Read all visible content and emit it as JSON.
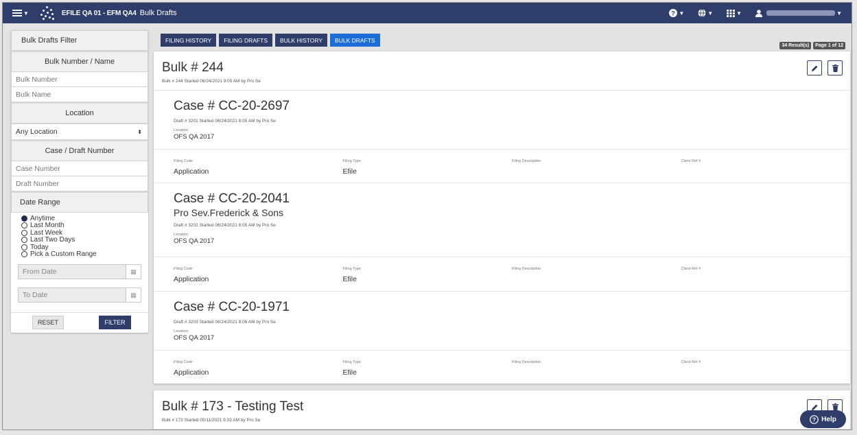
{
  "header": {
    "app_title": "EFILE QA 01 - EFM QA4",
    "page_title": "Bulk Drafts",
    "icons": [
      "menu-icon",
      "logo-icon",
      "help-icon",
      "globe-icon",
      "grid-icon",
      "user-icon"
    ]
  },
  "sidebar": {
    "title": "Bulk Drafts Filter",
    "bulk_section": "Bulk Number / Name",
    "bulk_number_placeholder": "Bulk Number",
    "bulk_name_placeholder": "Bulk Name",
    "location_section": "Location",
    "location_value": "Any Location",
    "case_section": "Case / Draft Number",
    "case_number_placeholder": "Case Number",
    "draft_number_placeholder": "Draft Number",
    "date_section": "Date Range",
    "date_options": [
      "Anytime",
      "Last Month",
      "Last Week",
      "Last Two Days",
      "Today",
      "Pick a Custom Range"
    ],
    "selected_date_option": "Anytime",
    "from_date_placeholder": "From Date",
    "to_date_placeholder": "To Date",
    "reset_label": "RESET",
    "filter_label": "FILTER"
  },
  "tabs": [
    "FILING HISTORY",
    "FILING DRAFTS",
    "BULK HISTORY",
    "BULK DRAFTS"
  ],
  "active_tab": "BULK DRAFTS",
  "results": {
    "count": "34 Result(s)",
    "page": "Page 1 of 12"
  },
  "filing_labels": {
    "code": "Filing Code",
    "type": "Filing Type",
    "description": "Filing Description",
    "client_ref": "Client Ref #"
  },
  "bulks": [
    {
      "title": "Bulk # 244",
      "meta": "Bulk # 244 Started 06/24/2021 9:05 AM by Pro Se",
      "cases": [
        {
          "title": "Case # CC-20-2697",
          "subtitle": "",
          "meta": "Draft # 3201 Started 06/24/2021 9:05 AM by Pro Se",
          "location_label": "Location",
          "location": "OFS QA 2017",
          "filing_code": "Application",
          "filing_type": "Efile",
          "filing_description": "",
          "client_ref": ""
        },
        {
          "title": "Case # CC-20-2041",
          "subtitle": "Pro Sev.Frederick & Sons",
          "meta": "Draft # 3202 Started 06/24/2021 9:05 AM by Pro Se",
          "location_label": "Location",
          "location": "OFS QA 2017",
          "filing_code": "Application",
          "filing_type": "Efile",
          "filing_description": "",
          "client_ref": ""
        },
        {
          "title": "Case # CC-20-1971",
          "subtitle": "",
          "meta": "Draft # 3203 Started 06/24/2021 9:06 AM by Pro Se",
          "location_label": "Location",
          "location": "OFS QA 2017",
          "filing_code": "Application",
          "filing_type": "Efile",
          "filing_description": "",
          "client_ref": ""
        }
      ]
    },
    {
      "title": "Bulk # 173 - Testing Test",
      "meta": "Bulk # 173 Started 05/11/2021 9:33 AM by Pro Se",
      "cases": []
    }
  ],
  "help_label": "Help",
  "colors": {
    "nav": "#2f3d6b",
    "active_tab": "#1d6dd9",
    "badge": "#555555"
  }
}
